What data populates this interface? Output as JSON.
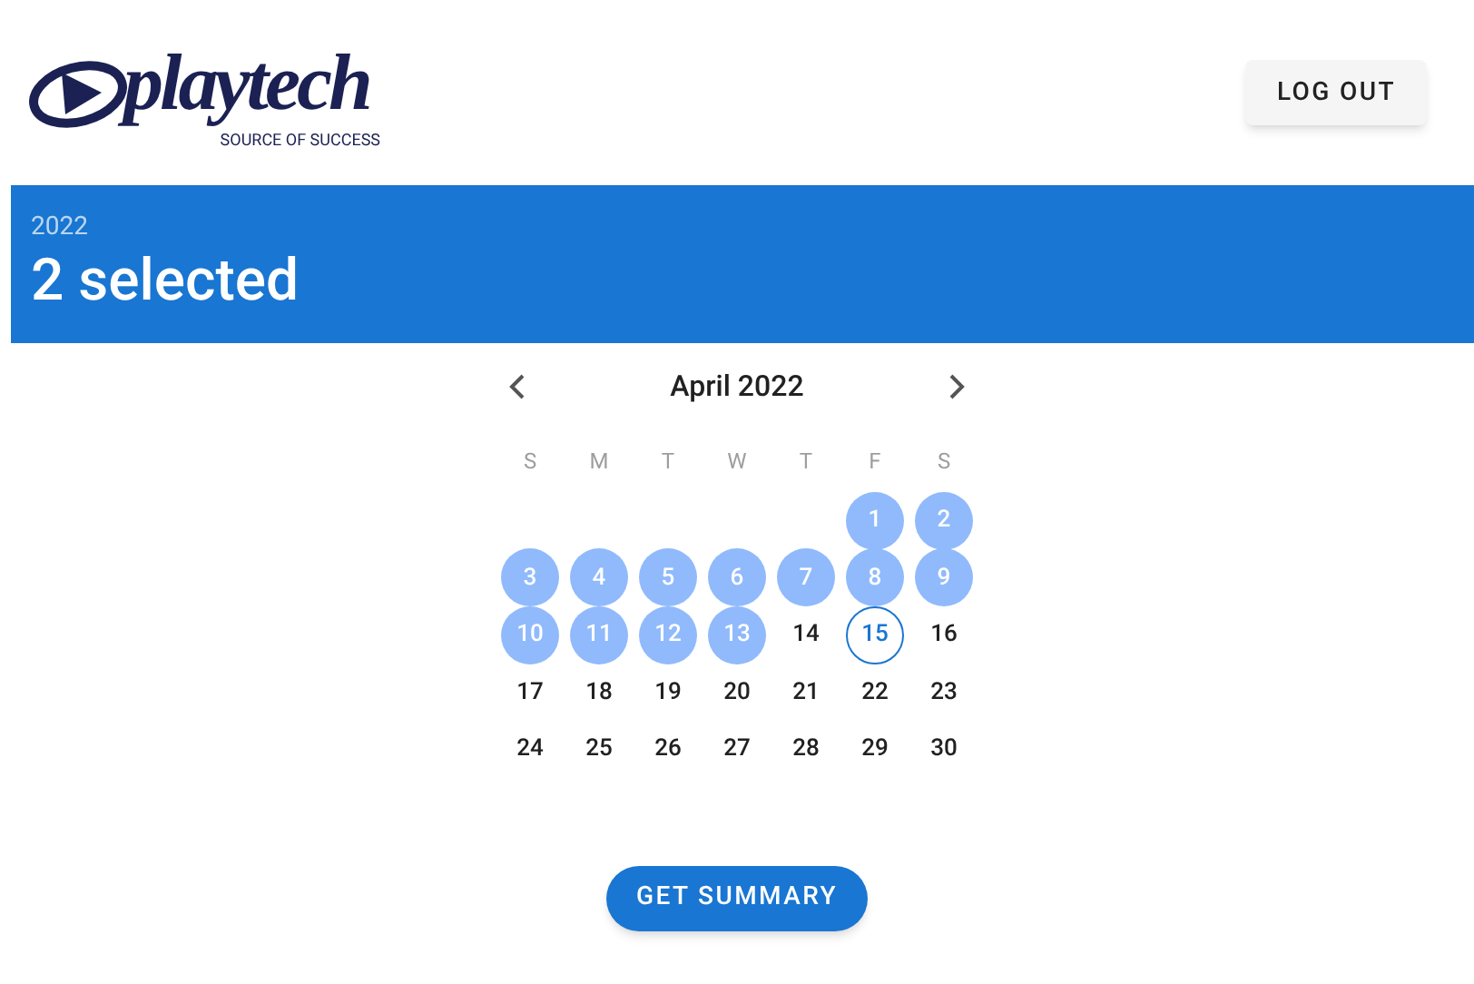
{
  "logo": {
    "wordmark": "playtech",
    "tagline": "SOURCE OF SUCCESS"
  },
  "logout_button": "LOG OUT",
  "selection_bar": {
    "year": "2022",
    "summary": "2 selected"
  },
  "calendar": {
    "month": "April 2022",
    "weekdays": [
      "S",
      "M",
      "T",
      "W",
      "T",
      "F",
      "S"
    ],
    "days": [
      {
        "kind": "blank"
      },
      {
        "kind": "blank"
      },
      {
        "kind": "blank"
      },
      {
        "kind": "blank"
      },
      {
        "kind": "blank"
      },
      {
        "kind": "day",
        "label": "1",
        "selected": true,
        "today": false
      },
      {
        "kind": "day",
        "label": "2",
        "selected": true,
        "today": false
      },
      {
        "kind": "day",
        "label": "3",
        "selected": true,
        "today": false
      },
      {
        "kind": "day",
        "label": "4",
        "selected": true,
        "today": false
      },
      {
        "kind": "day",
        "label": "5",
        "selected": true,
        "today": false
      },
      {
        "kind": "day",
        "label": "6",
        "selected": true,
        "today": false
      },
      {
        "kind": "day",
        "label": "7",
        "selected": true,
        "today": false
      },
      {
        "kind": "day",
        "label": "8",
        "selected": true,
        "today": false
      },
      {
        "kind": "day",
        "label": "9",
        "selected": true,
        "today": false
      },
      {
        "kind": "day",
        "label": "10",
        "selected": true,
        "today": false
      },
      {
        "kind": "day",
        "label": "11",
        "selected": true,
        "today": false
      },
      {
        "kind": "day",
        "label": "12",
        "selected": true,
        "today": false
      },
      {
        "kind": "day",
        "label": "13",
        "selected": true,
        "today": false
      },
      {
        "kind": "day",
        "label": "14",
        "selected": false,
        "today": false
      },
      {
        "kind": "day",
        "label": "15",
        "selected": false,
        "today": true
      },
      {
        "kind": "day",
        "label": "16",
        "selected": false,
        "today": false
      },
      {
        "kind": "day",
        "label": "17",
        "selected": false,
        "today": false
      },
      {
        "kind": "day",
        "label": "18",
        "selected": false,
        "today": false
      },
      {
        "kind": "day",
        "label": "19",
        "selected": false,
        "today": false
      },
      {
        "kind": "day",
        "label": "20",
        "selected": false,
        "today": false
      },
      {
        "kind": "day",
        "label": "21",
        "selected": false,
        "today": false
      },
      {
        "kind": "day",
        "label": "22",
        "selected": false,
        "today": false
      },
      {
        "kind": "day",
        "label": "23",
        "selected": false,
        "today": false
      },
      {
        "kind": "day",
        "label": "24",
        "selected": false,
        "today": false
      },
      {
        "kind": "day",
        "label": "25",
        "selected": false,
        "today": false
      },
      {
        "kind": "day",
        "label": "26",
        "selected": false,
        "today": false
      },
      {
        "kind": "day",
        "label": "27",
        "selected": false,
        "today": false
      },
      {
        "kind": "day",
        "label": "28",
        "selected": false,
        "today": false
      },
      {
        "kind": "day",
        "label": "29",
        "selected": false,
        "today": false
      },
      {
        "kind": "day",
        "label": "30",
        "selected": false,
        "today": false
      }
    ]
  },
  "summary_button": "GET SUMMARY"
}
